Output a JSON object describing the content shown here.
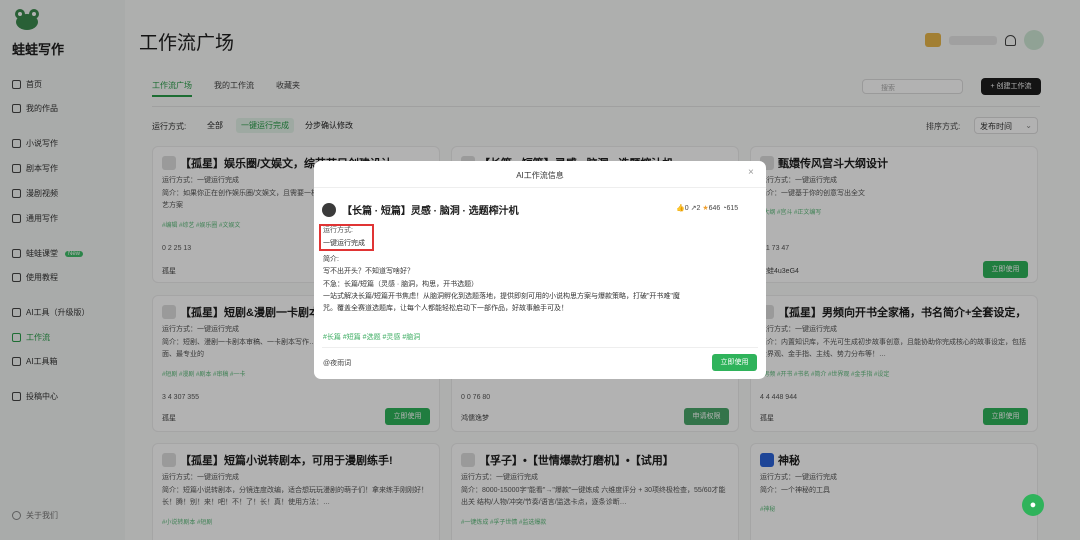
{
  "app": {
    "name": "蛙蛙写作"
  },
  "sidebar": {
    "items": [
      {
        "label": "首页",
        "icon": "home-icon"
      },
      {
        "label": "我的作品",
        "icon": "book-icon"
      },
      {
        "label": "小说写作",
        "icon": "pen-icon"
      },
      {
        "label": "剧本写作",
        "icon": "script-icon"
      },
      {
        "label": "漫剧视频",
        "icon": "video-icon"
      },
      {
        "label": "通用写作",
        "icon": "doc-icon"
      },
      {
        "label": "蛙蛙课堂",
        "icon": "class-icon",
        "badge": "New"
      },
      {
        "label": "使用教程",
        "icon": "info-icon"
      },
      {
        "label": "AI工具（升级版）",
        "icon": "ai-icon"
      },
      {
        "label": "工作流",
        "icon": "workflow-icon"
      },
      {
        "label": "AI工具箱",
        "icon": "toolbox-icon"
      },
      {
        "label": "投稿中心",
        "icon": "submit-icon"
      }
    ],
    "footer": "关于我们"
  },
  "header": {
    "title": "工作流广场"
  },
  "tabs": [
    "工作流广场",
    "我的工作流",
    "收藏夹"
  ],
  "search": {
    "placeholder": "搜索"
  },
  "create_button": "+ 创建工作流",
  "filter": {
    "label": "运行方式:",
    "options": [
      "全部",
      "一键运行完成",
      "分步确认修改"
    ]
  },
  "sort": {
    "label": "排序方式:",
    "value": "发布时间"
  },
  "cards": [
    {
      "title": "【孤星】娱乐圈/文娱文，综艺节目创建设计",
      "mode": "运行方式：一键运行完成",
      "desc": "简介：如果你正在创作娱乐圈/文娱文，且需要一档综艺节目。本工作流可帮你完成从标艺方案",
      "tags": "#编辑 #综艺 #娱乐圈 #文娱文",
      "stats": "0 2 25 13",
      "author": "孤星"
    },
    {
      "title": "【长篇 · 短篇】灵感 · 脑洞 · 选题榨汁机",
      "mode": "",
      "desc": "",
      "tags": "",
      "stats": "",
      "author": ""
    },
    {
      "title": "甄嬛传风宫斗大纲设计",
      "mode": "运行方式：一键运行完成",
      "desc": "简介：一键基于你的创意写出全文",
      "tags": "#大纲 #宫斗 #正文编写",
      "stats": "1 1 73 47",
      "author": "蛙蛙4u3eG4"
    },
    {
      "title": "【孤星】短剧&漫剧一卡剧本写作",
      "mode": "运行方式：一键运行完成",
      "desc": "简介：短剧、漫剧一卡剧本审稿、一卡剧本写作…正文、统统交给金牌编剧，给你最全面、最专业的",
      "tags": "#短剧 #漫剧 #剧本 #审稿 #一卡",
      "stats": "3 4 307 355",
      "author": "孤星"
    },
    {
      "title": "",
      "mode": "",
      "desc": "",
      "tags": "",
      "stats": "0 0 76 80",
      "author": "鸿儒逸梦"
    },
    {
      "title": "【孤星】男频向开书全家桶，书名简介+全套设定，",
      "mode": "运行方式：一键运行完成",
      "desc": "简介：内置知识库，不光可生成初步故事创意，且能协助你完成核心的故事设定，包括世界观、金手指、主线、势力分布等！…",
      "tags": "#男频 #开书 #书名 #简介 #世界观 #金手指 #设定",
      "stats": "4 4 448 944",
      "author": "孤星"
    },
    {
      "title": "【孤星】短篇小说转剧本，可用于漫剧练手!",
      "mode": "运行方式：一键运行完成",
      "desc": "简介：短篇小说转剧本，分镜连度改编，适合想玩玩漫剧的萌子们！拿来练手刚刚好！长！腾！别！来！吧！不！了！长！真！使用方法：…",
      "tags": "#小说转剧本 #短剧",
      "stats": "",
      "author": ""
    },
    {
      "title": "【孚子】•【世情爆款打磨机】•【试用】",
      "mode": "运行方式：一键运行完成",
      "desc": "简介：8000-15000字\"能看\"→\"爆款\"一键炼成 六维度评分 + 30项终极检查，55/60才能出关 结构/人物/冲突/节奏/语言/监选卡点，逐条诊断…",
      "tags": "#一键炼成 #孚子世情 #监选爆款",
      "stats": "",
      "author": ""
    },
    {
      "title": "神秘",
      "mode": "运行方式：一键运行完成",
      "desc": "简介：一个神秘的工具",
      "tags": "#神秘",
      "stats": "",
      "author": ""
    }
  ],
  "use_button": "立即使用",
  "apply_button": "申请权限",
  "modal": {
    "header": "AI工作流信息",
    "close": "×",
    "title": "【长篇 · 短篇】灵感 · 脑洞 · 选题榨汁机",
    "stats": {
      "likes": "0",
      "shares": "2",
      "stars": "646",
      "uses": "615"
    },
    "mode_label": "运行方式:",
    "mode_value": "一键运行完成",
    "desc_label": "简介:",
    "lines": [
      "写不出开头？不知道写啥好？",
      "不急：长篇/短篇（灵感 · 脑洞，构思，开书选题）",
      "一站式解决长篇/短篇开书焦虑！从脑洞孵化到选题落地，提供即刻可用的小说构思方案与爆款策略，打破\"开书难\"魔",
      "咒。覆盖全赛道选题库，让每个人都能轻松启动下一部作品，好故事触手可及！"
    ],
    "tags": "#长篇 #短篇 #选题 #灵感 #脑洞",
    "author": "@夜雨词",
    "use_button": "立即使用"
  },
  "colors": {
    "accent": "#2fb35b",
    "highlight": "#e03434"
  }
}
